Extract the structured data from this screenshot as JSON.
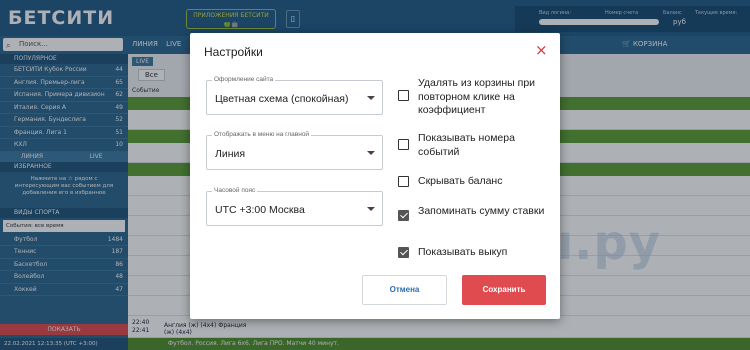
{
  "header": {
    "logo": "БЕТСИТИ",
    "apps_line1": "ПРИЛОЖЕНИЯ БЕТСИТИ",
    "apps_icons": "🍏🤖",
    "account_label1": "Вид логина:",
    "account_label2": "Номер счета",
    "balance_label": "Баланс",
    "time_label": "Текущее время:",
    "balance_value": "руб"
  },
  "nav": {
    "search_placeholder": "Поиск...",
    "liniya": "ЛИНИЯ",
    "live": "LIVE",
    "basket": "КОРЗИНА"
  },
  "sidebar": {
    "popular_title": "ПОПУЛЯРНОЕ",
    "items": [
      {
        "label": "БЕТСИТИ Кубок России",
        "count": "44"
      },
      {
        "label": "Англия. Премьер-лига",
        "count": "65"
      },
      {
        "label": "Испания. Примера дивизион",
        "count": "62"
      },
      {
        "label": "Италия. Серия А",
        "count": "49"
      },
      {
        "label": "Германия. Бундеслига",
        "count": "52"
      },
      {
        "label": "Франция. Лига 1",
        "count": "51"
      },
      {
        "label": "КХЛ",
        "count": "10"
      }
    ],
    "tab_liniya": "ЛИНИЯ",
    "tab_live": "LIVE",
    "favorites_title": "ИЗБРАННОЕ",
    "favorites_hint": "Нажмите на ☆ рядом с интересующим вас событием для добавления его в избранное",
    "sports_title": "ВИДЫ СПОРТА",
    "period": "События: все время",
    "sports": [
      {
        "label": "Футбол",
        "count": "1484"
      },
      {
        "label": "Теннис",
        "count": "187"
      },
      {
        "label": "Баскетбол",
        "count": "86"
      },
      {
        "label": "Волейбол",
        "count": "48"
      },
      {
        "label": "Хоккей",
        "count": "47"
      }
    ],
    "show_button": "ПОКАЗАТЬ",
    "datetime": "22.02.2021 12:13:35 (UTC +3:00)"
  },
  "modal": {
    "title": "Настройки",
    "close_label": "×",
    "selects": [
      {
        "label": "Оформление сайта",
        "value": "Цветная схема (спокойная)"
      },
      {
        "label": "Отображать в меню на главной",
        "value": "Линия"
      },
      {
        "label": "Часовой пояс",
        "value": "UTC +3:00 Москва"
      }
    ],
    "checkboxes": [
      {
        "label": "Удалять из корзины при повторном клике на коэффициент",
        "checked": false
      },
      {
        "label": "Показывать номера событий",
        "checked": false
      },
      {
        "label": "Скрывать баланс",
        "checked": false
      },
      {
        "label": "Запоминать сумму ставки",
        "checked": true
      },
      {
        "label": "Показывать выкуп",
        "checked": true
      }
    ],
    "cancel": "Отмена",
    "save": "Сохранить"
  },
  "watermark": "Букмекеры.ру",
  "main": {
    "live_tab": "LIVE",
    "all_btn": "Все",
    "event_header": "Событие",
    "bottom_row": "Футбол. Россия. Лига 6х6. Лига ПРО. Матчи 40 минут.",
    "match_row": "Англия (ж) (4х4) Франция (ж) (4х4)",
    "time1": "22:40",
    "time2": "22:41"
  },
  "colors": {
    "accent": "#e04b4f",
    "header_bg": "#1f5a86",
    "league_green": "#5a9d33"
  }
}
